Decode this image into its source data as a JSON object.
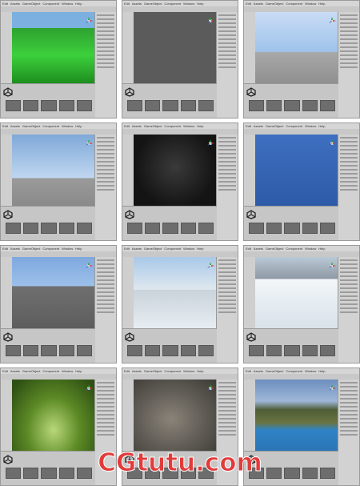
{
  "menu_items": [
    "Edit",
    "Assets",
    "GameObject",
    "Component",
    "Window",
    "Help"
  ],
  "watermark": "CGtutu.com",
  "tiles": [
    {
      "name": "tile-running-track"
    },
    {
      "name": "tile-character-rig"
    },
    {
      "name": "tile-particle-scene"
    },
    {
      "name": "tile-sky-particles"
    },
    {
      "name": "tile-dark-animator"
    },
    {
      "name": "tile-blue-character"
    },
    {
      "name": "tile-blue-props"
    },
    {
      "name": "tile-snow-scene"
    },
    {
      "name": "tile-arena-scene"
    },
    {
      "name": "tile-terrain-ui"
    },
    {
      "name": "tile-rocky-terrain"
    },
    {
      "name": "tile-mountain-lake"
    }
  ],
  "colors": {
    "unity_bg": "#c2c2c2",
    "watermark": "#e23b3b"
  }
}
